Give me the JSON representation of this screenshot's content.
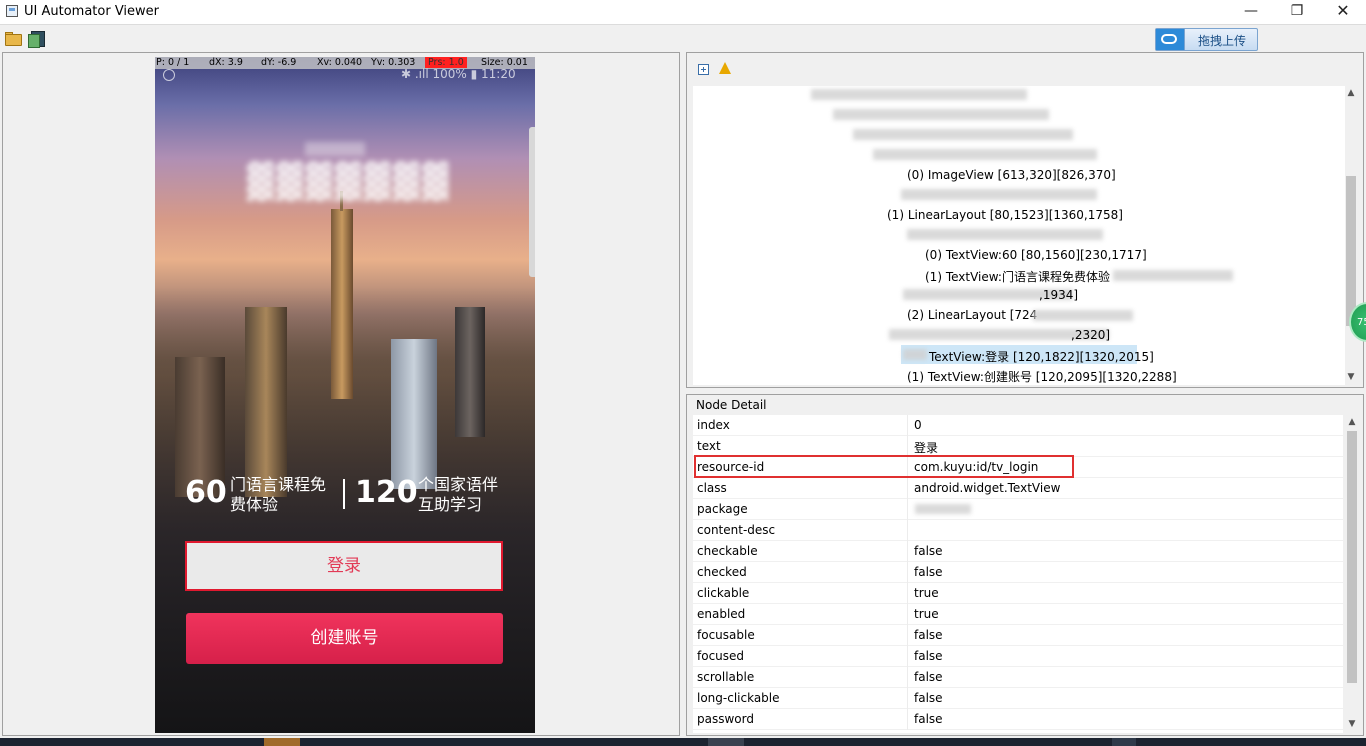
{
  "window": {
    "title": "UI Automator Viewer",
    "minimize": "—",
    "maximize": "❐",
    "close": "✕"
  },
  "toolbar": {
    "upload_label": "拖拽上传"
  },
  "device": {
    "debug": {
      "pointer": "P: 0 / 1",
      "dx": "dX: 3.9",
      "dy": "dY: -6.9",
      "xv": "Xv: 0.040",
      "yv": "Yv: 0.303",
      "prs": "Prs: 1.0",
      "size": "Size: 0.01"
    },
    "status": {
      "right": "✱ .ıll 100% ▮ 11:20"
    },
    "stats": [
      {
        "number": "60",
        "line1": "门语言课程免",
        "line2": "费体验"
      },
      {
        "number": "120",
        "line1": "个国家语伴",
        "line2": "互助学习"
      }
    ],
    "login_label": "登录",
    "create_label": "创建账号"
  },
  "tree": {
    "lines": [
      {
        "text": "(0) ImageView [613,320][826,370]"
      },
      {
        "text": "(1) LinearLayout [80,1523][1360,1758]"
      },
      {
        "text": "(0) TextView:60 [80,1560][230,1717]"
      },
      {
        "text": "(1) TextView:门语言课程免费体验"
      },
      {
        "text": ",1934]"
      },
      {
        "text": "(2) LinearLayout [724"
      },
      {
        "text": ",2320]"
      },
      {
        "text": "TextView:登录 [120,1822][1320,2015]"
      },
      {
        "text": "(1) TextView:创建账号 [120,2095][1320,2288]"
      }
    ]
  },
  "detail": {
    "title": "Node Detail",
    "rows": [
      {
        "key": "index",
        "value": "0"
      },
      {
        "key": "text",
        "value": "登录"
      },
      {
        "key": "resource-id",
        "value": "com.kuyu:id/tv_login"
      },
      {
        "key": "class",
        "value": "android.widget.TextView"
      },
      {
        "key": "package",
        "value": ""
      },
      {
        "key": "content-desc",
        "value": ""
      },
      {
        "key": "checkable",
        "value": "false"
      },
      {
        "key": "checked",
        "value": "false"
      },
      {
        "key": "clickable",
        "value": "true"
      },
      {
        "key": "enabled",
        "value": "true"
      },
      {
        "key": "focusable",
        "value": "false"
      },
      {
        "key": "focused",
        "value": "false"
      },
      {
        "key": "scrollable",
        "value": "false"
      },
      {
        "key": "long-clickable",
        "value": "false"
      },
      {
        "key": "password",
        "value": "false"
      }
    ]
  },
  "badge": {
    "label": "75"
  },
  "colors": {
    "accent": "#e0192f",
    "selection": "#cde6f7",
    "highlight": "#e03030",
    "create_button": "#e8285a"
  }
}
